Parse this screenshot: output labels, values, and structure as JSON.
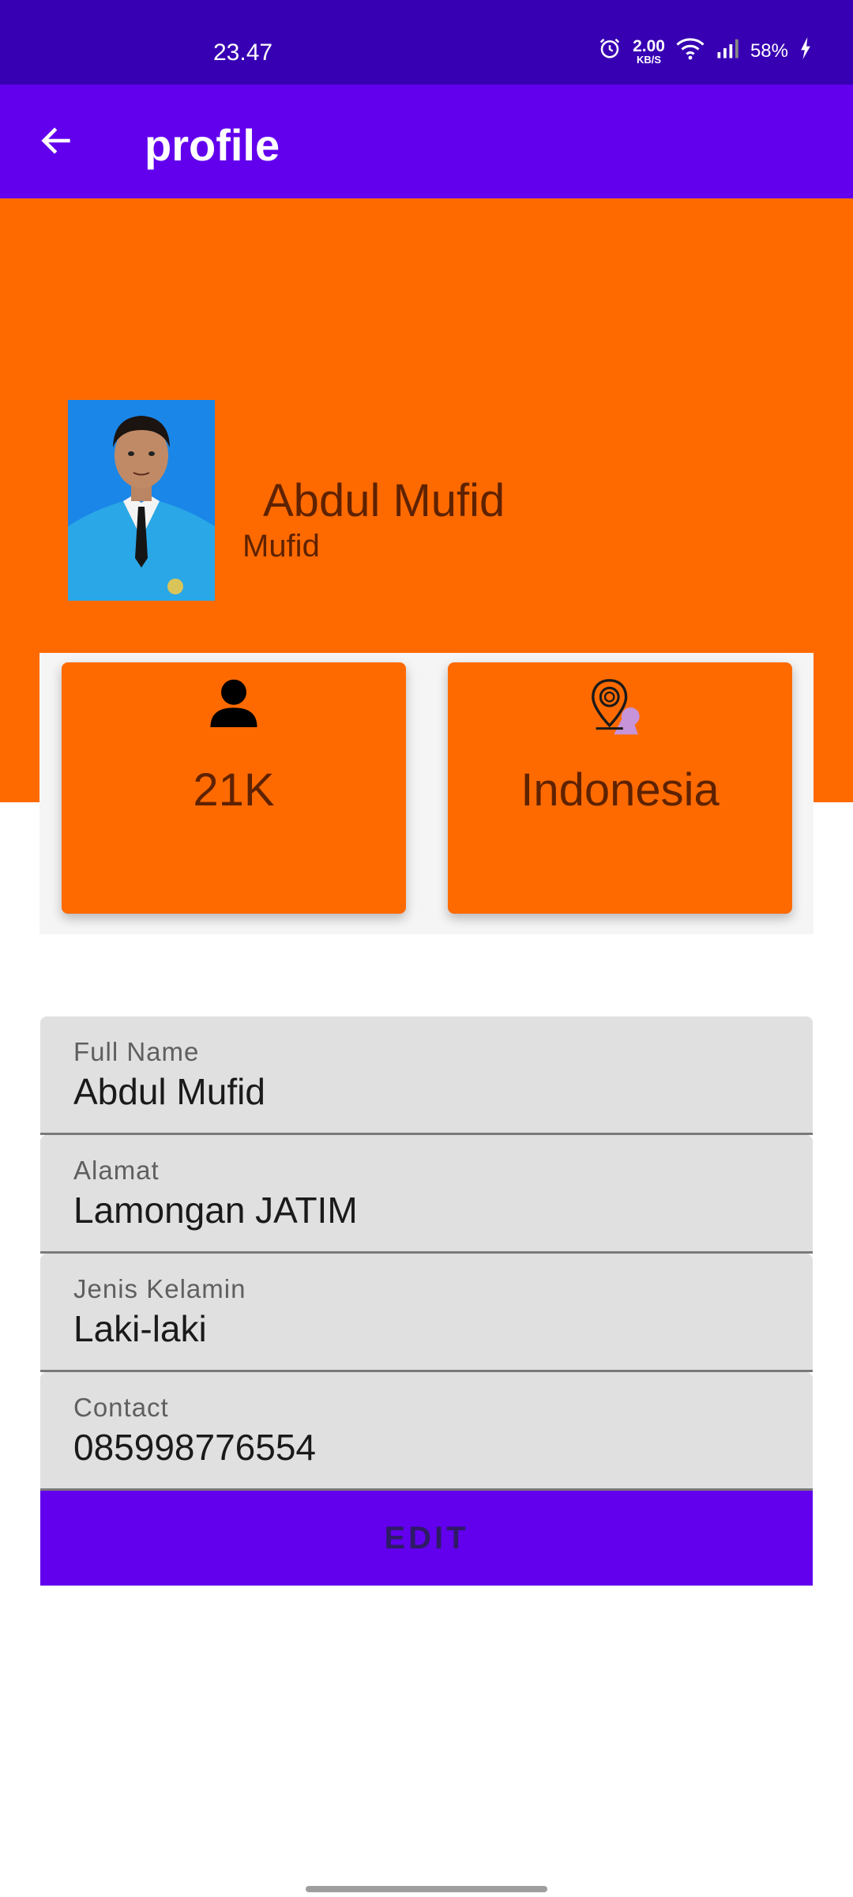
{
  "status_bar": {
    "time": "23.47",
    "speed_value": "2.00",
    "speed_unit": "KB/S",
    "battery": "58%"
  },
  "app_bar": {
    "title": "profile",
    "back_icon": "arrow-left-icon"
  },
  "profile": {
    "name": "Abdul Mufid",
    "username": "Mufid",
    "photo_icon": "profile-photo"
  },
  "stats": {
    "followers": {
      "icon": "person-icon",
      "value": "21K"
    },
    "location": {
      "icon": "map-pin-icon",
      "value": "Indonesia"
    }
  },
  "fields": [
    {
      "label": "Full Name",
      "value": "Abdul Mufid"
    },
    {
      "label": "Alamat",
      "value": "Lamongan JATIM"
    },
    {
      "label": "Jenis Kelamin",
      "value": "Laki-laki"
    },
    {
      "label": "Contact",
      "value": "085998776554"
    }
  ],
  "edit_button": {
    "label": "EDIT"
  },
  "colors": {
    "status_bar": "#3700b3",
    "primary": "#6200ee",
    "accent_orange": "#ff6a00",
    "text_dark_orange": "#5e2200"
  }
}
